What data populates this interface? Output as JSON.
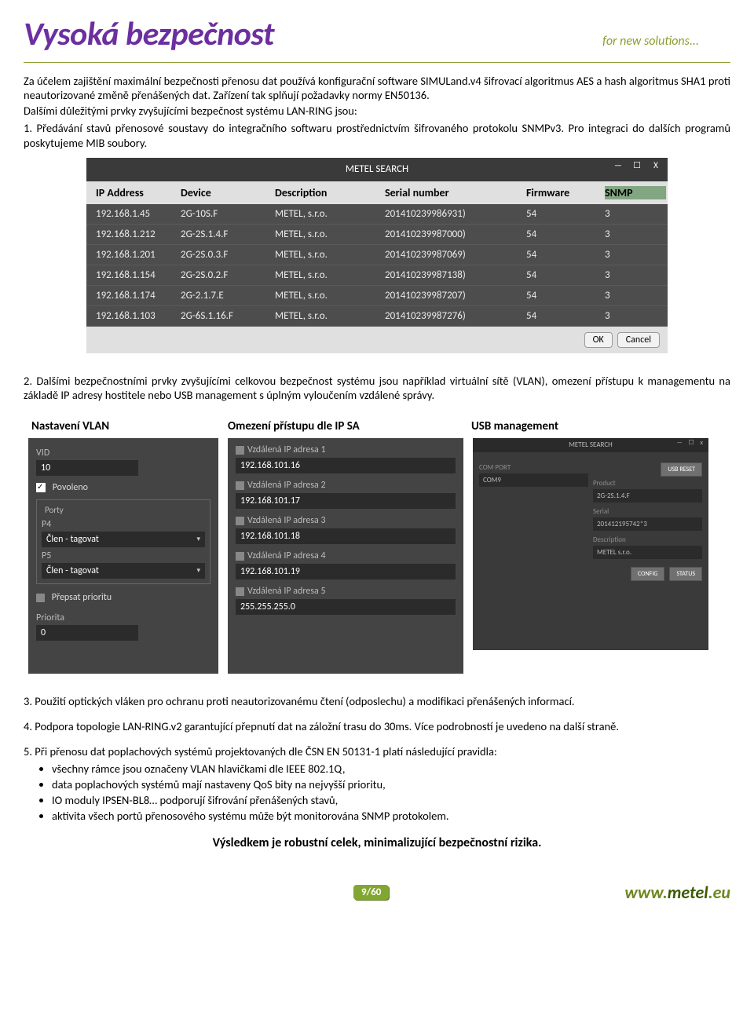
{
  "header": {
    "title": "Vysoká bezpečnost",
    "tagline": "for new solutions..."
  },
  "intro": {
    "p1": "Za účelem zajištění maximální bezpečnosti přenosu dat používá konfigurační software SIMULand.v4 šifrovací algoritmus AES a hash algoritmus SHA1 proti neautorizované změně přenášených dat. Zařízení tak splňují požadavky normy EN50136.",
    "p2": "Dalšími důležitými prvky zvyšujícími bezpečnost systému LAN-RING jsou:",
    "p3": "1. Předávání stavů přenosové soustavy do integračního softwaru prostřednictvím šifrovaného protokolu SNMPv3. Pro integraci do dalších programů poskytujeme MIB soubory."
  },
  "metel_search": {
    "title": "METEL SEARCH",
    "columns": [
      "IP Address",
      "Device",
      "Description",
      "Serial number",
      "Firmware",
      "SNMP"
    ],
    "rows": [
      [
        "192.168.1.45",
        "2G-10S.F",
        "METEL, s.r.o.",
        "201410239986931)",
        "54",
        "3"
      ],
      [
        "192.168.1.212",
        "2G-2S.1.4.F",
        "METEL, s.r.o.",
        "201410239987000)",
        "54",
        "3"
      ],
      [
        "192.168.1.201",
        "2G-2S.0.3.F",
        "METEL, s.r.o.",
        "201410239987069)",
        "54",
        "3"
      ],
      [
        "192.168.1.154",
        "2G-2S.0.2.F",
        "METEL, s.r.o.",
        "201410239987138)",
        "54",
        "3"
      ],
      [
        "192.168.1.174",
        "2G-2.1.7.E",
        "METEL, s.r.o.",
        "201410239987207)",
        "54",
        "3"
      ],
      [
        "192.168.1.103",
        "2G-6S.1.16.F",
        "METEL, s.r.o.",
        "201410239987276)",
        "54",
        "3"
      ]
    ],
    "ok": "OK",
    "cancel": "Cancel"
  },
  "para2": "2. Dalšími bezpečnostními prvky zvyšujícími celkovou bezpečnost systému jsou například virtuální sítě (VLAN), omezení přístupu k managementu na základě IP adresy hostitele nebo USB management s úplným vyloučením vzdálené správy.",
  "labels": {
    "l1": "Nastavení VLAN",
    "l2": "Omezení přístupu dle IP SA",
    "l3": "USB management"
  },
  "vlan": {
    "vid_lbl": "VID",
    "vid": "10",
    "povoleno": "Povoleno",
    "porty": "Porty",
    "p4": "P4",
    "p5": "P5",
    "sel1": "Člen - tagovat",
    "sel2": "Člen - tagovat",
    "prepsat": "Přepsat prioritu",
    "prio_lbl": "Priorita",
    "prio": "0"
  },
  "ipsa": {
    "items": [
      {
        "lbl": "Vzdálená IP adresa 1",
        "val": "192.168.101.16"
      },
      {
        "lbl": "Vzdálená IP adresa 2",
        "val": "192.168.101.17"
      },
      {
        "lbl": "Vzdálená IP adresa 3",
        "val": "192.168.101.18"
      },
      {
        "lbl": "Vzdálená IP adresa 4",
        "val": "192.168.101.19"
      },
      {
        "lbl": "Vzdálená IP adresa 5",
        "val": "255.255.255.0"
      }
    ]
  },
  "usb": {
    "title": "METEL SEARCH",
    "comport_lbl": "COM PORT",
    "comport": "COM9",
    "reset": "USB RESET",
    "product_lbl": "Product",
    "product": "2G-2S.1.4.F",
    "serial_lbl": "Serial",
    "serial": "201412195742*3",
    "desc_lbl": "Description",
    "desc": "METEL s.r.o.",
    "config": "CONFIG",
    "status": "STATUS"
  },
  "para3": "3. Použití optických vláken pro ochranu proti neautorizovanému čtení (odposlechu) a modifikaci přenášených informací.",
  "para4": "4. Podpora topologie LAN-RING.v2 garantující přepnutí dat na záložní trasu do 30ms. Více podrobností je uvedeno na další straně.",
  "para5": "5. Při přenosu dat poplachových systémů projektovaných dle ČSN EN 50131-1 platí následující pravidla:",
  "bullets": [
    "všechny rámce jsou označeny VLAN hlavičkami dle IEEE 802.1Q,",
    "data poplachových systémů mají nastaveny QoS bity na nejvyšší prioritu,",
    "IO moduly IPSEN-BL8… podporují šifrování přenášených stavů,",
    "aktivita všech portů přenosového systému může být monitorována SNMP protokolem."
  ],
  "conclusion": "Výsledkem je robustní celek, minimalizující bezpečnostní rizika.",
  "footer": {
    "page": "9/60",
    "url_pre": "www.",
    "url_b": "metel",
    "url_post": ".eu"
  }
}
